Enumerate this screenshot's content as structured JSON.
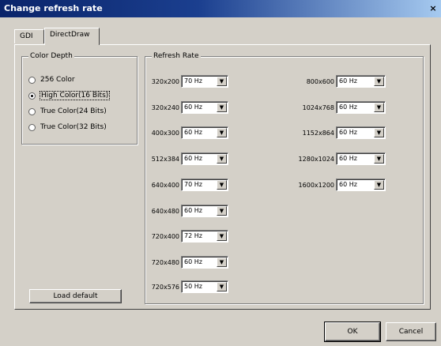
{
  "window": {
    "title": "Change refresh rate",
    "close_glyph": "×"
  },
  "tabs": [
    {
      "label": "GDI"
    },
    {
      "label": "DirectDraw"
    }
  ],
  "color_depth": {
    "title": "Color Depth",
    "selected": "High Color(16 Bits)",
    "options": [
      {
        "label": "256 Color",
        "selected": false
      },
      {
        "label": "High Color(16 Bits)",
        "selected": true
      },
      {
        "label": "True Color(24 Bits)",
        "selected": false
      },
      {
        "label": "True Color(32 Bits)",
        "selected": false
      }
    ]
  },
  "refresh_rate": {
    "title": "Refresh Rate",
    "left": [
      {
        "res": "320x200",
        "rate": "70 Hz"
      },
      {
        "res": "320x240",
        "rate": "60 Hz"
      },
      {
        "res": "400x300",
        "rate": "60 Hz"
      },
      {
        "res": "512x384",
        "rate": "60 Hz"
      },
      {
        "res": "640x400",
        "rate": "70 Hz"
      },
      {
        "res": "640x480",
        "rate": "60 Hz"
      },
      {
        "res": "720x400",
        "rate": "72 Hz"
      },
      {
        "res": "720x480",
        "rate": "60 Hz"
      },
      {
        "res": "720x576",
        "rate": "50 Hz"
      }
    ],
    "right": [
      {
        "res": "800x600",
        "rate": "60 Hz"
      },
      {
        "res": "1024x768",
        "rate": "60 Hz"
      },
      {
        "res": "1152x864",
        "rate": "60 Hz"
      },
      {
        "res": "1280x1024",
        "rate": "60 Hz"
      },
      {
        "res": "1600x1200",
        "rate": "60 Hz"
      }
    ]
  },
  "buttons": {
    "load_default": "Load default",
    "ok": "OK",
    "cancel": "Cancel"
  },
  "icons": {
    "dropdown_arrow": "▼"
  }
}
